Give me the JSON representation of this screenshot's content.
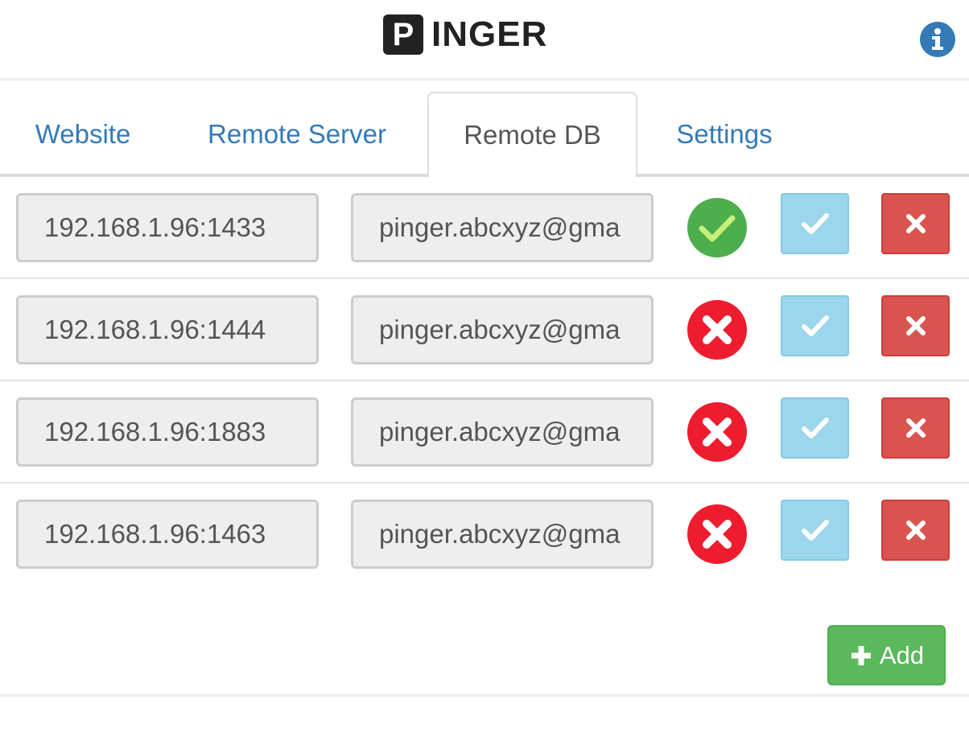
{
  "app": {
    "logo_letter": "P",
    "logo_text": "INGER",
    "info_icon": "info-icon"
  },
  "tabs": [
    {
      "label": "Website",
      "active": false
    },
    {
      "label": "Remote Server",
      "active": false
    },
    {
      "label": "Remote DB",
      "active": true
    },
    {
      "label": "Settings",
      "active": false
    }
  ],
  "rows": [
    {
      "address": "192.168.1.96:1433",
      "email": "pinger.abcxyz@gma",
      "status": "ok"
    },
    {
      "address": "192.168.1.96:1444",
      "email": "pinger.abcxyz@gma",
      "status": "error"
    },
    {
      "address": "192.168.1.96:1883",
      "email": "pinger.abcxyz@gma",
      "status": "error"
    },
    {
      "address": "192.168.1.96:1463",
      "email": "pinger.abcxyz@gma",
      "status": "error"
    }
  ],
  "actions": {
    "add_label": "Add"
  },
  "colors": {
    "link": "#337ab7",
    "status_ok": "#4cae4c",
    "status_error": "#ee1c2e",
    "save_button": "#9bd6ec",
    "delete_button": "#d9534f",
    "add_button": "#5cb85c"
  }
}
